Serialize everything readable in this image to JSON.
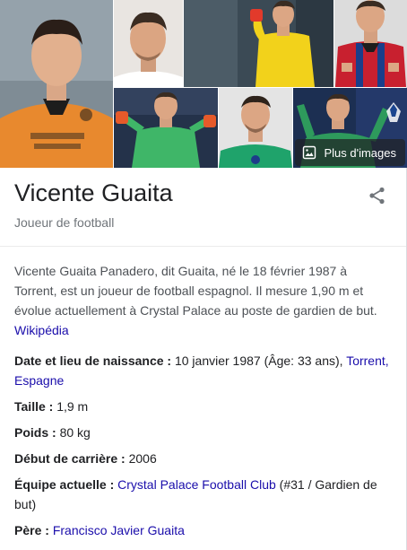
{
  "image_grid": {
    "more_images_label": "Plus d'images",
    "tiles": [
      {
        "name": "photo-valencia-portrait",
        "jersey_color": "#e8892e",
        "bg": "#7d8a93"
      },
      {
        "name": "photo-studio-headshot",
        "jersey_color": "#ffffff",
        "bg": "#e9e5e1"
      },
      {
        "name": "photo-yellow-goalkeeper-kit",
        "jersey_color": "#f2d21b",
        "bg": "#3b4a55"
      },
      {
        "name": "photo-crystal-palace-kit",
        "jersey_color": "#c8202f",
        "bg": "#dcdcdc"
      },
      {
        "name": "photo-green-kit-gloves",
        "jersey_color": "#3fb668",
        "bg": "#24324a"
      },
      {
        "name": "photo-getafe-headshot",
        "jersey_color": "#1fa36b",
        "bg": "#e4e4e4"
      },
      {
        "name": "photo-celebrating-green-kit",
        "jersey_color": "#2e9a5c",
        "bg": "#1c2f52"
      }
    ]
  },
  "header": {
    "title": "Vicente Guaita",
    "subtitle": "Joueur de football",
    "share_icon": "share-icon"
  },
  "description": {
    "text": "Vicente Guaita Panadero, dit Guaita, né le 18 février 1987 à Torrent, est un joueur de football espagnol. Il mesure 1,90 m et évolue actuellement à Crystal Palace au poste de gardien de but.",
    "source_link": "Wikipédia"
  },
  "facts": {
    "birth": {
      "label": "Date et lieu de naissance :",
      "value": "10 janvier 1987 (Âge: 33 ans),",
      "link": "Torrent, Espagne"
    },
    "height": {
      "label": "Taille :",
      "value": "1,9 m"
    },
    "weight": {
      "label": "Poids :",
      "value": "80 kg"
    },
    "career_start": {
      "label": "Début de carrière :",
      "value": "2006"
    },
    "team": {
      "label": "Équipe actuelle :",
      "link": "Crystal Palace Football Club",
      "value": "(#31 / Gardien de but)"
    },
    "father": {
      "label": "Père :",
      "link": "Francisco Javier Guaita"
    }
  },
  "colors": {
    "link": "#1a0dab",
    "text": "#202124",
    "muted": "#70757a",
    "body_text": "#4d5156"
  }
}
